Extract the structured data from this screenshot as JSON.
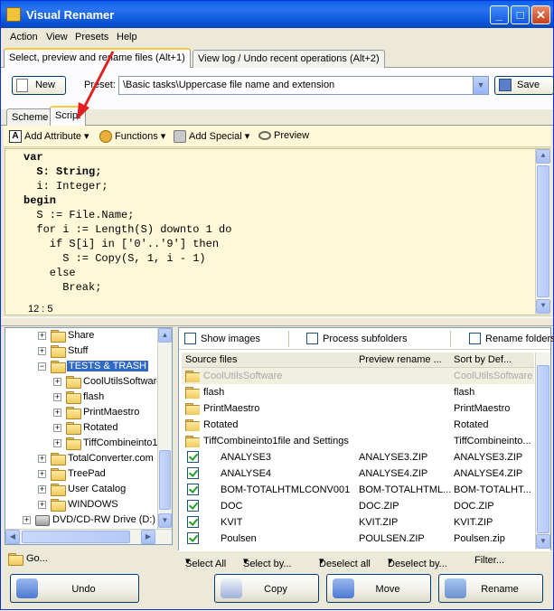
{
  "window": {
    "title": "Visual Renamer"
  },
  "menu": [
    "Action",
    "View",
    "Presets",
    "Help"
  ],
  "main_tabs": [
    {
      "label": "Select, preview and rename files (Alt+1)"
    },
    {
      "label": "View log / Undo recent operations (Alt+2)"
    }
  ],
  "toolbar": {
    "new_label": "New",
    "preset_label": "Preset:",
    "preset_value": "\\Basic tasks\\Uppercase file name and extension",
    "save_label": "Save"
  },
  "sub_tabs": [
    {
      "label": "Scheme"
    },
    {
      "label": "Script"
    }
  ],
  "script_toolbar": {
    "add_attribute": "Add Attribute",
    "functions": "Functions",
    "add_special": "Add Special",
    "preview": "Preview"
  },
  "editor": {
    "lines": [
      "var",
      "  S: String;",
      "  i: Integer;",
      "begin",
      "  S := File.Name;",
      "  for i := Length(S) downto 1 do",
      "    if S[i] in ['0'..'9'] then",
      "      S := Copy(S, 1, i - 1)",
      "    else",
      "      Break;"
    ],
    "cursor_pos": "12 : 5"
  },
  "tree": {
    "items": [
      {
        "label": "Share"
      },
      {
        "label": "Stuff"
      },
      {
        "label": "TESTS & TRASH"
      },
      {
        "label": "CoolUtilsSoftware"
      },
      {
        "label": "flash"
      },
      {
        "label": "PrintMaestro"
      },
      {
        "label": "Rotated"
      },
      {
        "label": "TiffCombineinto1"
      },
      {
        "label": "TotalConverter.com"
      },
      {
        "label": "TreePad"
      },
      {
        "label": "User Catalog"
      },
      {
        "label": "WINDOWS"
      },
      {
        "label": "DVD/CD-RW Drive (D:)"
      }
    ],
    "go_label": "Go..."
  },
  "options": {
    "show_images": "Show images",
    "process_subfolders": "Process subfolders",
    "rename_folders": "Rename folders"
  },
  "file_list": {
    "headers": [
      "Source files",
      "Preview rename ...",
      "Sort by Def..."
    ],
    "rows": [
      {
        "name": "CoolUtilsSoftware",
        "preview": "",
        "sort": "CoolUtilsSoftware"
      },
      {
        "name": "flash",
        "preview": "",
        "sort": "flash"
      },
      {
        "name": "PrintMaestro",
        "preview": "",
        "sort": "PrintMaestro"
      },
      {
        "name": "Rotated",
        "preview": "",
        "sort": "Rotated"
      },
      {
        "name": "TiffCombineinto1file and Settings",
        "preview": "",
        "sort": "TiffCombineinto..."
      },
      {
        "name": "ANALYSE3",
        "preview": "ANALYSE3.ZIP",
        "sort": "ANALYSE3.ZIP"
      },
      {
        "name": "ANALYSE4",
        "preview": "ANALYSE4.ZIP",
        "sort": "ANALYSE4.ZIP"
      },
      {
        "name": "BOM-TOTALHTMLCONV001",
        "preview": "BOM-TOTALHTML...",
        "sort": "BOM-TOTALHT..."
      },
      {
        "name": "DOC",
        "preview": "DOC.ZIP",
        "sort": "DOC.ZIP"
      },
      {
        "name": "KVIT",
        "preview": "KVIT.ZIP",
        "sort": "KVIT.ZIP"
      },
      {
        "name": "Poulsen",
        "preview": "POULSEN.ZIP",
        "sort": "Poulsen.zip"
      }
    ]
  },
  "list_actions": {
    "select_all": "Select All",
    "select_by": "Select by...",
    "deselect_all": "Deselect all",
    "deselect_by": "Deselect by...",
    "filter": "Filter..."
  },
  "actions": {
    "undo": "Undo",
    "copy": "Copy",
    "move": "Move",
    "rename": "Rename"
  },
  "colors": {
    "accent": "#316ac5",
    "editor_bg": "#fff8d8",
    "annotation_arrow": "#e02020"
  }
}
